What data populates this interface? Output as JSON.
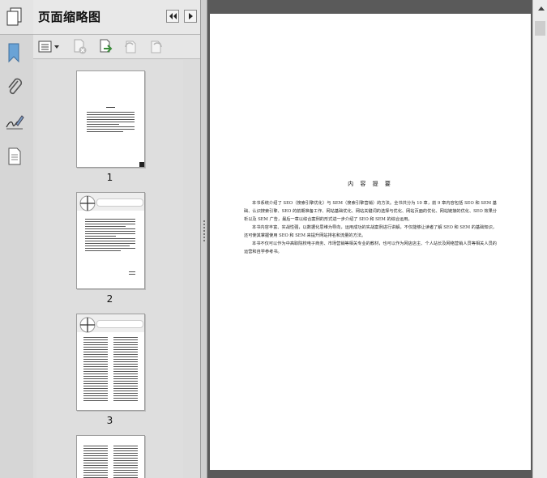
{
  "panel": {
    "title": "页面缩略图",
    "thumbnails": [
      {
        "number": "1"
      },
      {
        "number": "2"
      },
      {
        "number": "3"
      }
    ]
  },
  "icons": {
    "strip": [
      "pages-icon",
      "bookmark-icon",
      "attachment-icon",
      "signature-icon",
      "layers-icon"
    ],
    "panel_header": [
      "collapse-left-icon",
      "collapse-right-icon"
    ],
    "toolbar": [
      "options-menu-icon",
      "delete-page-icon",
      "extract-page-icon",
      "rotate-left-icon",
      "rotate-right-icon"
    ]
  },
  "document": {
    "page_title": "内 容 提 要",
    "paragraphs": [
      "本书系统介绍了 SEO（搜索引擎优化）与 SEM（搜索引擎营销）的方法。全书共分为 10 章，前 9 章内容包括 SEO 和 SEM 基础、认识搜索引擎、SEO 的前期准备工作、网站基础优化、网站关键词的选择与优化、网站页面的优化、网站链接的优化、SEO 效果分析以及 SEM 广告，最后一章以综合案例的形式进一步介绍了 SEO 和 SEM 的综合运用。",
      "本书内容丰富、实战性强，以数据化思维为导向，运用成功的实战案例进行讲解，不仅能够让读者了解 SEO 和 SEM 的基础知识，还可使其掌握使用 SEO 和 SEM 来提升网站排名和流量的方法。",
      "本书不仅可以作为中高职院校电子商务、市场营销等相关专业的教材，也可以作为网店店主、个人站长及网络营销人员等相关人员的运营和自学参考书。"
    ]
  },
  "colors": {
    "panel_bg": "#dcdcdc",
    "doc_bg": "#5a5a5a",
    "page_bg": "#ffffff"
  }
}
